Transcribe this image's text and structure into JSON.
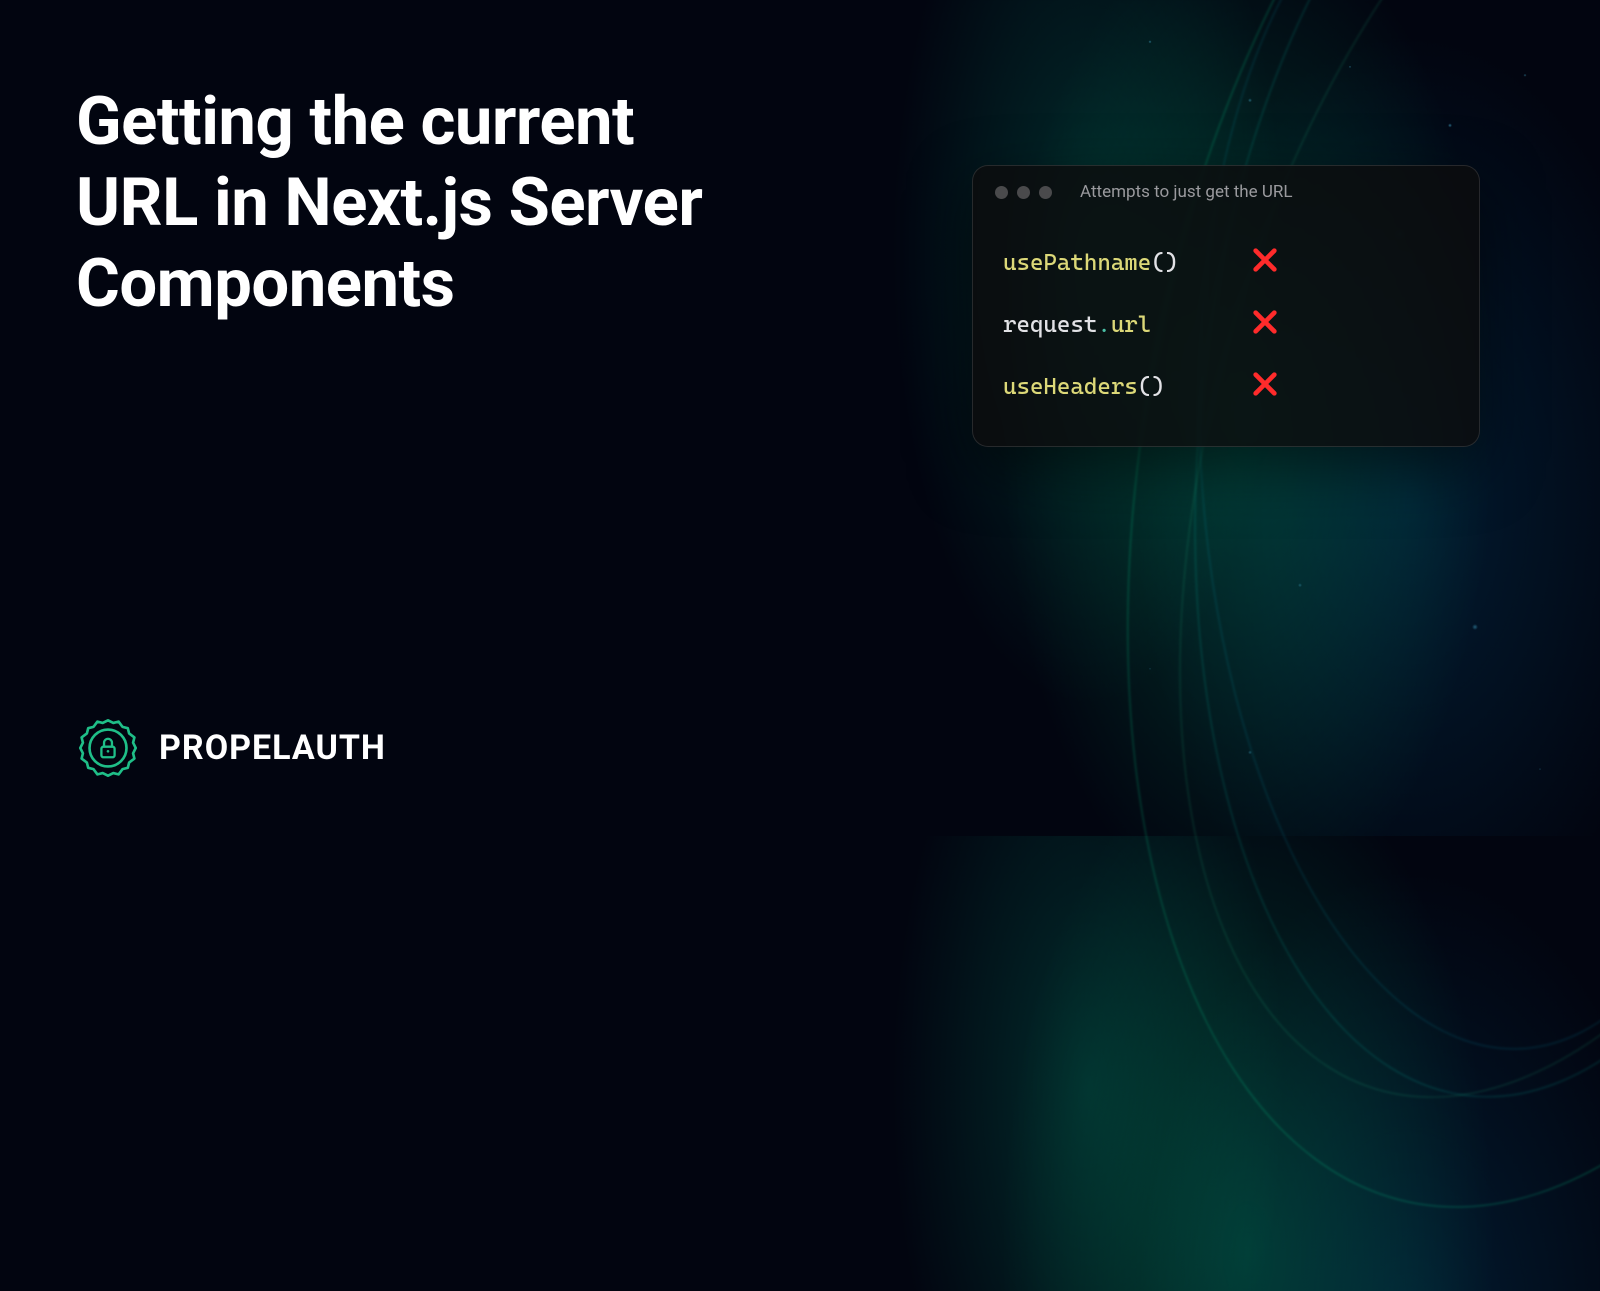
{
  "headline": "Getting the current URL in Next.js Server Components",
  "codePanel": {
    "title": "Attempts to just get the URL",
    "rows": [
      {
        "segments": [
          {
            "text": "usePathname",
            "cls": "t-yellow"
          },
          {
            "text": "()",
            "cls": "t-white"
          }
        ]
      },
      {
        "segments": [
          {
            "text": "request",
            "cls": "t-white"
          },
          {
            "text": ".",
            "cls": "t-teal"
          },
          {
            "text": "url",
            "cls": "t-yellow"
          }
        ]
      },
      {
        "segments": [
          {
            "text": "useHeaders",
            "cls": "t-yellow"
          },
          {
            "text": "()",
            "cls": "t-white"
          }
        ]
      }
    ]
  },
  "brand": {
    "name": "PROPELAUTH",
    "accentColor": "#1fbf88"
  }
}
